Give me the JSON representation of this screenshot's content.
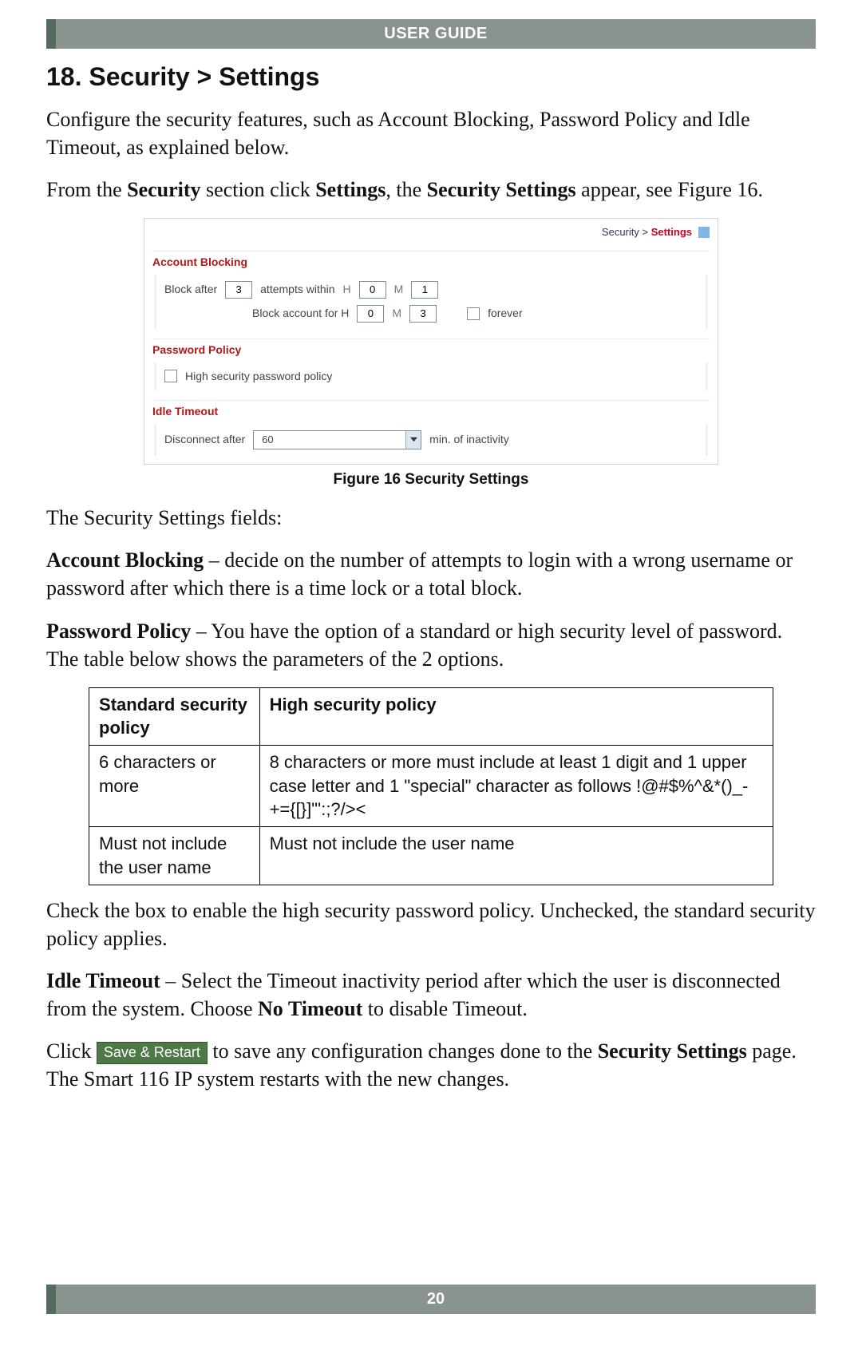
{
  "banner": "USER GUIDE",
  "h1": "18. Security > Settings",
  "intro": "Configure the security features, such as Account Blocking, Password Policy and Idle Timeout, as explained below.",
  "nav_sentence": {
    "pre": "From the ",
    "s1": "Security",
    "mid1": " section click ",
    "s2": "Settings",
    "mid2": ", the ",
    "s3": "Security Settings",
    "post": " appear, see Figure 16."
  },
  "shot": {
    "breadcrumb": {
      "a": "Security > ",
      "b": "Settings"
    },
    "account": {
      "title": "Account Blocking",
      "block_after": "Block after",
      "block_after_val": "3",
      "attempts_within": "attempts within",
      "aw_h": "0",
      "aw_m": "1",
      "block_for": "Block account for  H",
      "bf_h": "0",
      "bf_m": "3",
      "forever": "forever",
      "H": "H",
      "M": "M"
    },
    "password": {
      "title": "Password Policy",
      "opt": "High security password policy"
    },
    "idle": {
      "title": "Idle Timeout",
      "disc": "Disconnect after",
      "val": "60",
      "unit": "min. of inactivity"
    }
  },
  "fig_caption": "Figure 16 Security Settings",
  "fields_intro": "The Security Settings fields:",
  "acct_para": {
    "lead": "Account Blocking",
    "rest": " – decide on the number of attempts to login with a wrong username or password after which there is a time lock or a total block."
  },
  "pw_para": {
    "lead": "Password Policy",
    "rest": " – You have the option of a standard or high security level of password. The table below shows the parameters of the 2 options."
  },
  "table": {
    "h1": "Standard security policy",
    "h2": "High security policy",
    "r1c1": "6 characters or more",
    "r1c2": "8 characters or more must include at least 1 digit and 1 upper case letter and 1 \"special\" character as follows !@#$%^&*()_-+={[}]\"':;?/><",
    "r2c1": "Must not include the user name",
    "r2c2": "Must not include the user name"
  },
  "checkbox_note": "Check the box to enable the high security password policy. Unchecked, the standard security policy applies.",
  "idle_para": {
    "lead": "Idle Timeout",
    "mid": " – Select the Timeout inactivity period after which the user is disconnected from the system. Choose ",
    "nt": "No Timeout",
    "end": " to disable Timeout."
  },
  "save": {
    "pre": "Click ",
    "btn": "Save & Restart",
    "mid": " to save any configuration changes done to the ",
    "ss": "Security Settings",
    "end": " page. The Smart 116 IP system restarts with the new changes."
  },
  "pagenum": "20"
}
